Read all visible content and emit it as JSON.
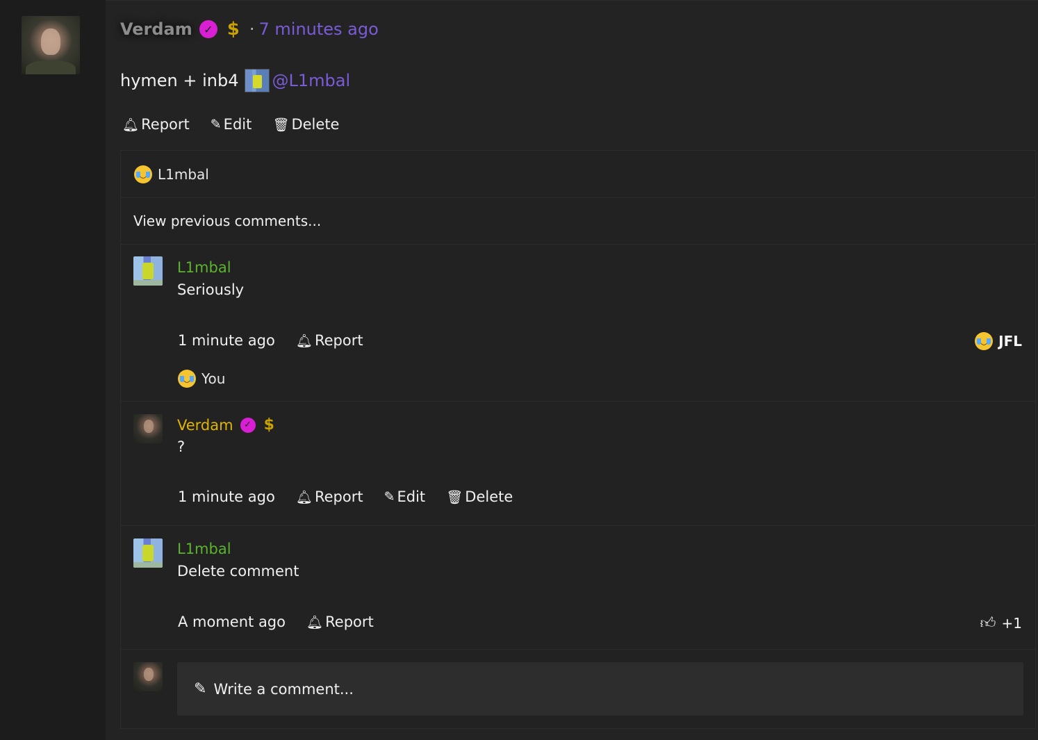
{
  "post": {
    "author": "Verdam",
    "time": "7 minutes ago",
    "dot": "·",
    "body_text": "hymen + inb4",
    "mention": "@L1mbal",
    "actions": {
      "report": "Report",
      "edit": "Edit",
      "delete": "Delete"
    }
  },
  "reactions": {
    "reactor": "L1mbal"
  },
  "comments": {
    "view_previous": "View previous comments...",
    "items": [
      {
        "author": "L1mbal",
        "text": "Seriously",
        "time": "1 minute ago",
        "report": "Report",
        "reaction_label": "JFL",
        "reactor": "You"
      },
      {
        "author": "Verdam",
        "text": "?",
        "time": "1 minute ago",
        "report": "Report",
        "edit": "Edit",
        "delete": "Delete"
      },
      {
        "author": "L1mbal",
        "text": "Delete comment",
        "time": "A moment ago",
        "report": "Report",
        "likes": "+1"
      }
    ],
    "write_placeholder": "Write a comment..."
  },
  "icons": {
    "verified": "check-circle-icon",
    "dollar": "dollar-icon",
    "report": "bell-icon",
    "edit": "pencil-icon",
    "delete": "trash-icon",
    "reaction": "crying-laughing-emoji-icon",
    "like": "thumbs-up-icon"
  },
  "colors": {
    "background": "#232323",
    "green_name": "#5ab42c",
    "gold_name": "#e0b400",
    "purple_link": "#7a5bd8",
    "verified_badge": "#d91fd3"
  }
}
